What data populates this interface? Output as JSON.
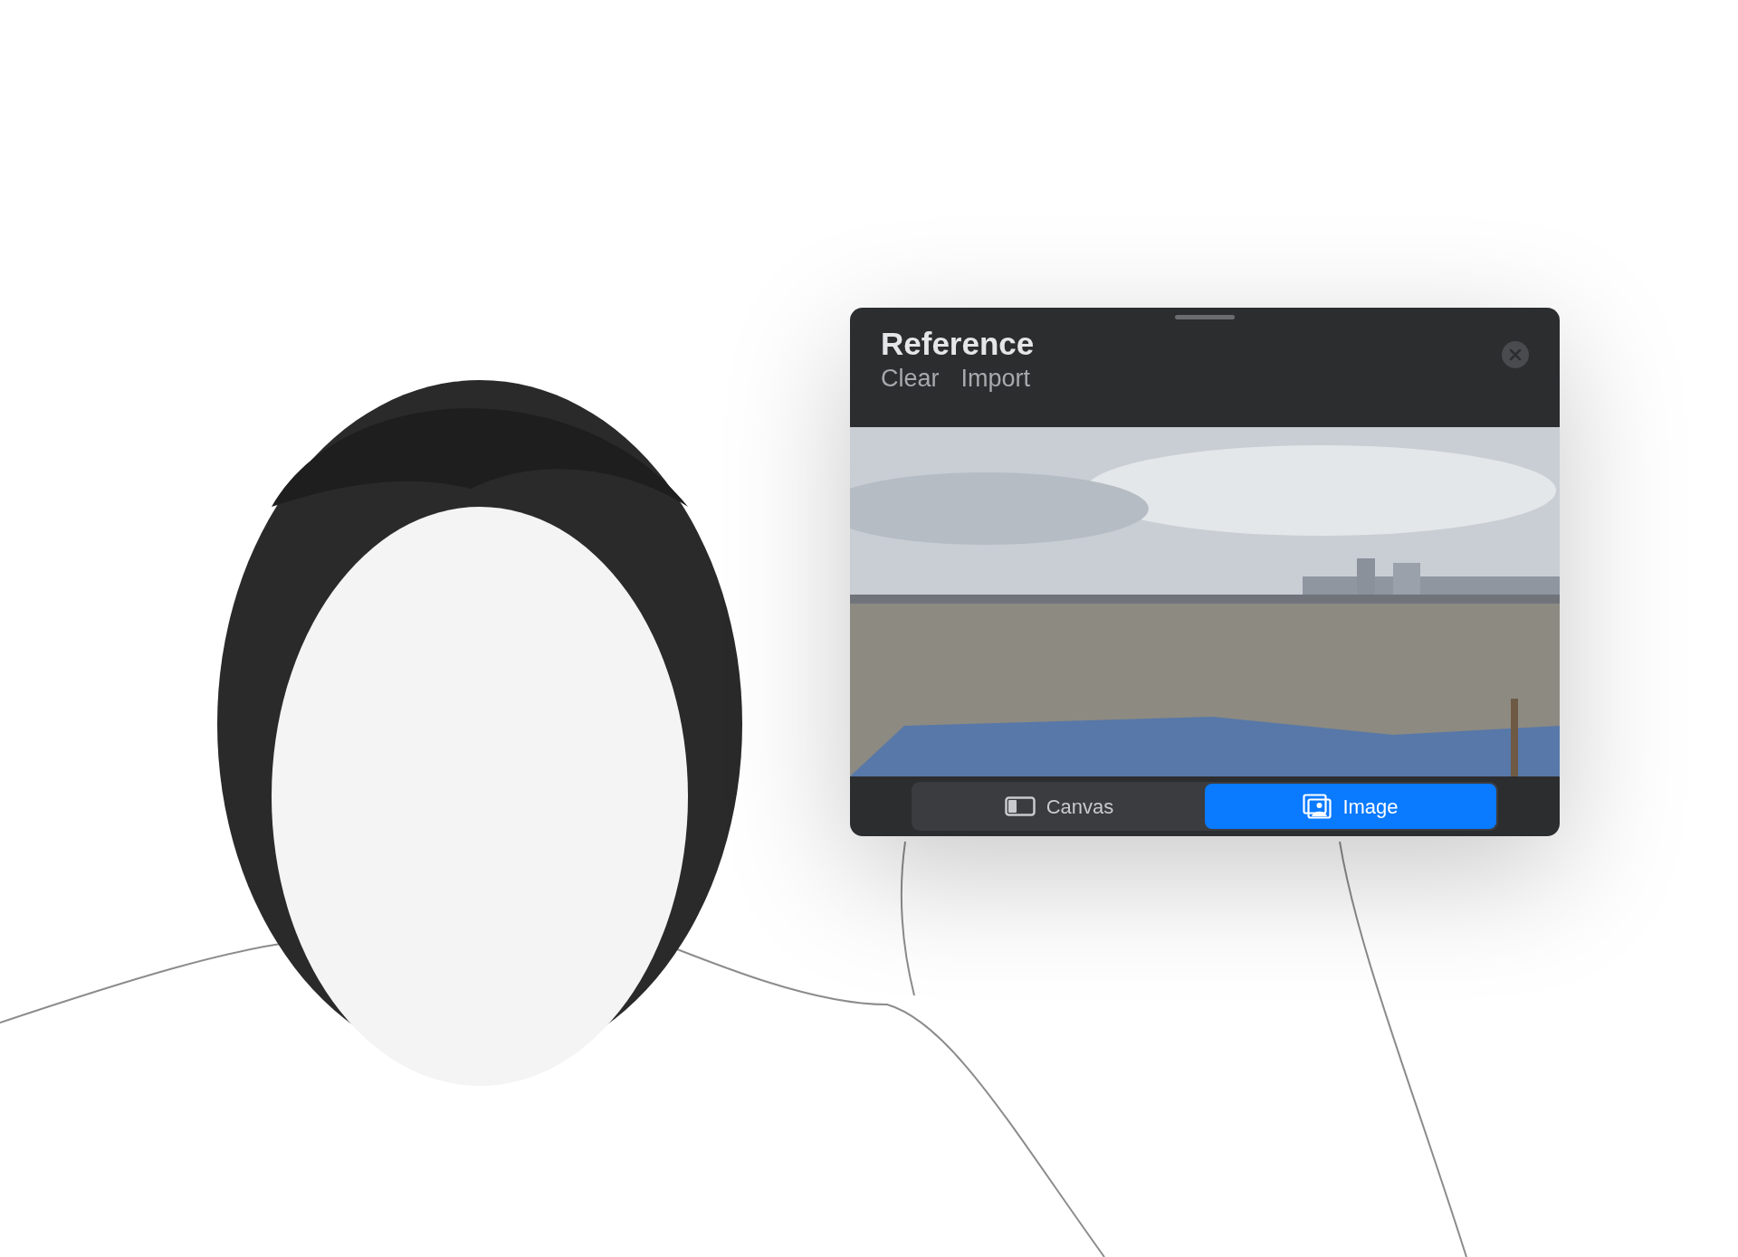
{
  "reference": {
    "title": "Reference",
    "actions": [
      "Clear",
      "Import"
    ],
    "modes": [
      {
        "kind": "canvas",
        "label": "Canvas",
        "selected": false
      },
      {
        "label": "Image",
        "selected": true
      }
    ]
  }
}
